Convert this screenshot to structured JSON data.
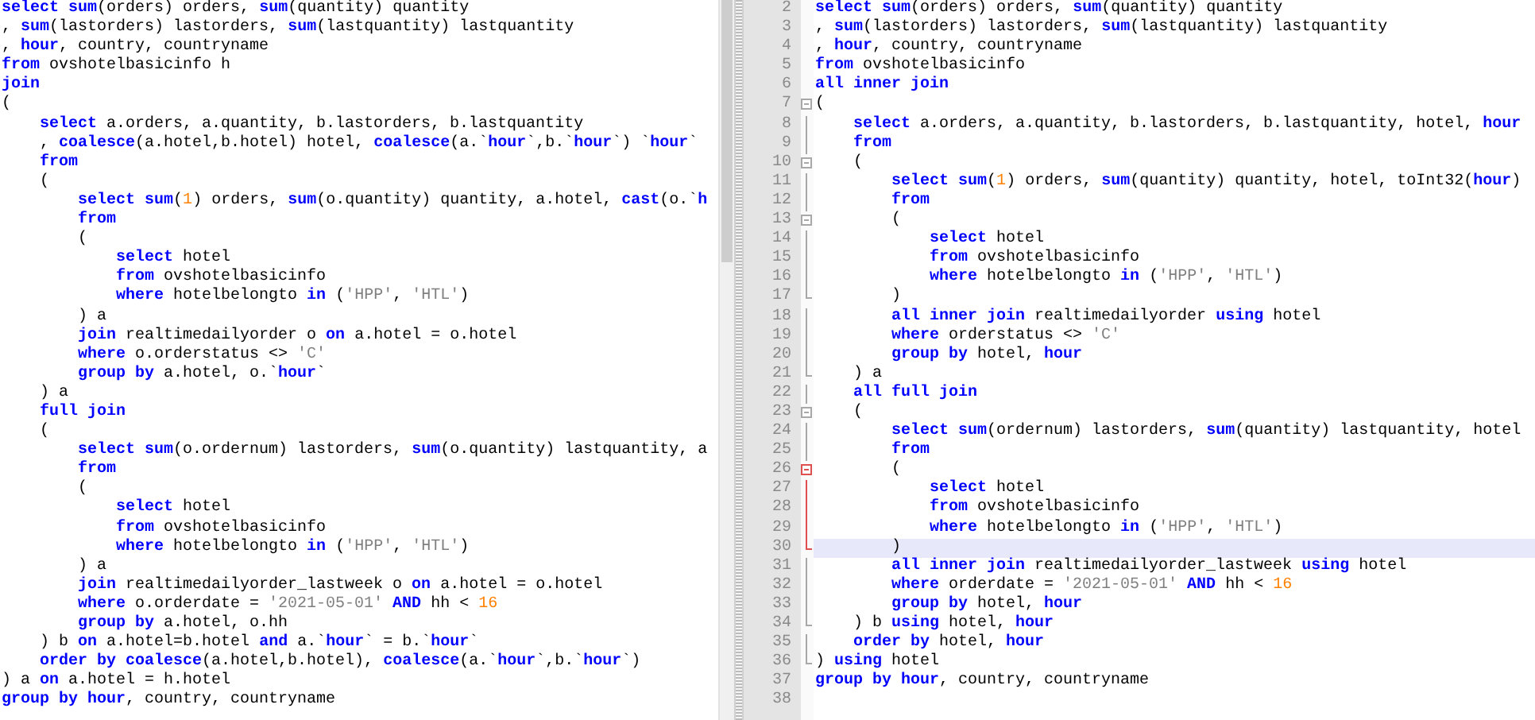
{
  "left_pane": {
    "lines": [
      {
        "tokens": [
          {
            "kind": "keyword",
            "text": "select "
          },
          {
            "kind": "keyword",
            "text": "sum"
          },
          {
            "kind": "text",
            "text": "(orders) orders, "
          },
          {
            "kind": "keyword",
            "text": "sum"
          },
          {
            "kind": "text",
            "text": "(quantity) quantity"
          }
        ]
      },
      {
        "tokens": [
          {
            "kind": "text",
            "text": ", "
          },
          {
            "kind": "keyword",
            "text": "sum"
          },
          {
            "kind": "text",
            "text": "(lastorders) lastorders, "
          },
          {
            "kind": "keyword",
            "text": "sum"
          },
          {
            "kind": "text",
            "text": "(lastquantity) lastquantity"
          }
        ]
      },
      {
        "tokens": [
          {
            "kind": "text",
            "text": ", "
          },
          {
            "kind": "keyword",
            "text": "hour"
          },
          {
            "kind": "text",
            "text": ", country, countryname"
          }
        ]
      },
      {
        "tokens": [
          {
            "kind": "keyword",
            "text": "from"
          },
          {
            "kind": "text",
            "text": " ovshotelbasicinfo h"
          }
        ]
      },
      {
        "tokens": [
          {
            "kind": "keyword",
            "text": "join"
          }
        ]
      },
      {
        "tokens": [
          {
            "kind": "text",
            "text": "("
          }
        ]
      },
      {
        "tokens": [
          {
            "kind": "keyword",
            "text": "    select"
          },
          {
            "kind": "text",
            "text": " a.orders, a.quantity, b.lastorders, b.lastquantity"
          }
        ]
      },
      {
        "tokens": [
          {
            "kind": "text",
            "text": "    , "
          },
          {
            "kind": "keyword",
            "text": "coalesce"
          },
          {
            "kind": "text",
            "text": "(a.hotel,b.hotel) hotel, "
          },
          {
            "kind": "keyword",
            "text": "coalesce"
          },
          {
            "kind": "text",
            "text": "(a.`"
          },
          {
            "kind": "keyword",
            "text": "hour"
          },
          {
            "kind": "text",
            "text": "`,b.`"
          },
          {
            "kind": "keyword",
            "text": "hour"
          },
          {
            "kind": "text",
            "text": "`) `"
          },
          {
            "kind": "keyword",
            "text": "hour"
          },
          {
            "kind": "text",
            "text": "`"
          }
        ]
      },
      {
        "tokens": [
          {
            "kind": "keyword",
            "text": "    from"
          }
        ]
      },
      {
        "tokens": [
          {
            "kind": "text",
            "text": "    ("
          }
        ]
      },
      {
        "tokens": [
          {
            "kind": "keyword",
            "text": "        select "
          },
          {
            "kind": "keyword",
            "text": "sum"
          },
          {
            "kind": "text",
            "text": "("
          },
          {
            "kind": "number",
            "text": "1"
          },
          {
            "kind": "text",
            "text": ") orders, "
          },
          {
            "kind": "keyword",
            "text": "sum"
          },
          {
            "kind": "text",
            "text": "(o.quantity) quantity, a.hotel, "
          },
          {
            "kind": "keyword",
            "text": "cast"
          },
          {
            "kind": "text",
            "text": "(o.`"
          },
          {
            "kind": "keyword",
            "text": "h"
          }
        ]
      },
      {
        "tokens": [
          {
            "kind": "keyword",
            "text": "        from"
          }
        ]
      },
      {
        "tokens": [
          {
            "kind": "text",
            "text": "        ("
          }
        ]
      },
      {
        "tokens": [
          {
            "kind": "keyword",
            "text": "            select"
          },
          {
            "kind": "text",
            "text": " hotel"
          }
        ]
      },
      {
        "tokens": [
          {
            "kind": "keyword",
            "text": "            from"
          },
          {
            "kind": "text",
            "text": " ovshotelbasicinfo"
          }
        ]
      },
      {
        "tokens": [
          {
            "kind": "keyword",
            "text": "            where"
          },
          {
            "kind": "text",
            "text": " hotelbelongto "
          },
          {
            "kind": "keyword",
            "text": "in"
          },
          {
            "kind": "text",
            "text": " ("
          },
          {
            "kind": "string",
            "text": "'HPP'"
          },
          {
            "kind": "text",
            "text": ", "
          },
          {
            "kind": "string",
            "text": "'HTL'"
          },
          {
            "kind": "text",
            "text": ")"
          }
        ]
      },
      {
        "tokens": [
          {
            "kind": "text",
            "text": "        ) a"
          }
        ]
      },
      {
        "tokens": [
          {
            "kind": "keyword",
            "text": "        join"
          },
          {
            "kind": "text",
            "text": " realtimedailyorder o "
          },
          {
            "kind": "keyword",
            "text": "on"
          },
          {
            "kind": "text",
            "text": " a.hotel = o.hotel"
          }
        ]
      },
      {
        "tokens": [
          {
            "kind": "keyword",
            "text": "        where"
          },
          {
            "kind": "text",
            "text": " o.orderstatus <> "
          },
          {
            "kind": "string",
            "text": "'C'"
          }
        ]
      },
      {
        "tokens": [
          {
            "kind": "keyword",
            "text": "        group by"
          },
          {
            "kind": "text",
            "text": " a.hotel, o.`"
          },
          {
            "kind": "keyword",
            "text": "hour"
          },
          {
            "kind": "text",
            "text": "`"
          }
        ]
      },
      {
        "tokens": [
          {
            "kind": "text",
            "text": "    ) a"
          }
        ]
      },
      {
        "tokens": [
          {
            "kind": "keyword",
            "text": "    full join"
          }
        ]
      },
      {
        "tokens": [
          {
            "kind": "text",
            "text": "    ("
          }
        ]
      },
      {
        "tokens": [
          {
            "kind": "keyword",
            "text": "        select "
          },
          {
            "kind": "keyword",
            "text": "sum"
          },
          {
            "kind": "text",
            "text": "(o.ordernum) lastorders, "
          },
          {
            "kind": "keyword",
            "text": "sum"
          },
          {
            "kind": "text",
            "text": "(o.quantity) lastquantity, a"
          }
        ]
      },
      {
        "tokens": [
          {
            "kind": "keyword",
            "text": "        from"
          }
        ]
      },
      {
        "tokens": [
          {
            "kind": "text",
            "text": "        ("
          }
        ]
      },
      {
        "tokens": [
          {
            "kind": "keyword",
            "text": "            select"
          },
          {
            "kind": "text",
            "text": " hotel"
          }
        ]
      },
      {
        "tokens": [
          {
            "kind": "keyword",
            "text": "            from"
          },
          {
            "kind": "text",
            "text": " ovshotelbasicinfo"
          }
        ]
      },
      {
        "tokens": [
          {
            "kind": "keyword",
            "text": "            where"
          },
          {
            "kind": "text",
            "text": " hotelbelongto "
          },
          {
            "kind": "keyword",
            "text": "in"
          },
          {
            "kind": "text",
            "text": " ("
          },
          {
            "kind": "string",
            "text": "'HPP'"
          },
          {
            "kind": "text",
            "text": ", "
          },
          {
            "kind": "string",
            "text": "'HTL'"
          },
          {
            "kind": "text",
            "text": ")"
          }
        ]
      },
      {
        "tokens": [
          {
            "kind": "text",
            "text": "        ) a"
          }
        ]
      },
      {
        "tokens": [
          {
            "kind": "keyword",
            "text": "        join"
          },
          {
            "kind": "text",
            "text": " realtimedailyorder_lastweek o "
          },
          {
            "kind": "keyword",
            "text": "on"
          },
          {
            "kind": "text",
            "text": " a.hotel = o.hotel"
          }
        ]
      },
      {
        "tokens": [
          {
            "kind": "keyword",
            "text": "        where"
          },
          {
            "kind": "text",
            "text": " o.orderdate = "
          },
          {
            "kind": "string",
            "text": "'2021-05-01'"
          },
          {
            "kind": "keyword",
            "text": " AND"
          },
          {
            "kind": "text",
            "text": " hh < "
          },
          {
            "kind": "number",
            "text": "16"
          }
        ]
      },
      {
        "tokens": [
          {
            "kind": "keyword",
            "text": "        group by"
          },
          {
            "kind": "text",
            "text": " a.hotel, o.hh"
          }
        ]
      },
      {
        "tokens": [
          {
            "kind": "text",
            "text": "    ) b "
          },
          {
            "kind": "keyword",
            "text": "on"
          },
          {
            "kind": "text",
            "text": " a.hotel=b.hotel "
          },
          {
            "kind": "keyword",
            "text": "and"
          },
          {
            "kind": "text",
            "text": " a.`"
          },
          {
            "kind": "keyword",
            "text": "hour"
          },
          {
            "kind": "text",
            "text": "` = b.`"
          },
          {
            "kind": "keyword",
            "text": "hour"
          },
          {
            "kind": "text",
            "text": "`"
          }
        ]
      },
      {
        "tokens": [
          {
            "kind": "keyword",
            "text": "    order by "
          },
          {
            "kind": "keyword",
            "text": "coalesce"
          },
          {
            "kind": "text",
            "text": "(a.hotel,b.hotel), "
          },
          {
            "kind": "keyword",
            "text": "coalesce"
          },
          {
            "kind": "text",
            "text": "(a.`"
          },
          {
            "kind": "keyword",
            "text": "hour"
          },
          {
            "kind": "text",
            "text": "`,b.`"
          },
          {
            "kind": "keyword",
            "text": "hour"
          },
          {
            "kind": "text",
            "text": "`)"
          }
        ]
      },
      {
        "tokens": [
          {
            "kind": "text",
            "text": ") a "
          },
          {
            "kind": "keyword",
            "text": "on"
          },
          {
            "kind": "text",
            "text": " a.hotel = h.hotel"
          }
        ]
      },
      {
        "tokens": [
          {
            "kind": "keyword",
            "text": "group by "
          },
          {
            "kind": "keyword",
            "text": "hour"
          },
          {
            "kind": "text",
            "text": ", country, countryname"
          }
        ]
      }
    ]
  },
  "right_pane": {
    "lines": [
      {
        "number": "2",
        "current": false,
        "tokens": [
          {
            "kind": "keyword",
            "text": "select "
          },
          {
            "kind": "keyword",
            "text": "sum"
          },
          {
            "kind": "text",
            "text": "(orders) orders, "
          },
          {
            "kind": "keyword",
            "text": "sum"
          },
          {
            "kind": "text",
            "text": "(quantity) quantity"
          }
        ]
      },
      {
        "number": "3",
        "current": false,
        "tokens": [
          {
            "kind": "text",
            "text": ", "
          },
          {
            "kind": "keyword",
            "text": "sum"
          },
          {
            "kind": "text",
            "text": "(lastorders) lastorders, "
          },
          {
            "kind": "keyword",
            "text": "sum"
          },
          {
            "kind": "text",
            "text": "(lastquantity) lastquantity"
          }
        ]
      },
      {
        "number": "4",
        "current": false,
        "tokens": [
          {
            "kind": "text",
            "text": ", "
          },
          {
            "kind": "keyword",
            "text": "hour"
          },
          {
            "kind": "text",
            "text": ", country, countryname"
          }
        ]
      },
      {
        "number": "5",
        "current": false,
        "tokens": [
          {
            "kind": "keyword",
            "text": "from"
          },
          {
            "kind": "text",
            "text": " ovshotelbasicinfo"
          }
        ]
      },
      {
        "number": "6",
        "current": false,
        "tokens": [
          {
            "kind": "keyword",
            "text": "all inner join"
          }
        ]
      },
      {
        "number": "7",
        "current": false,
        "kind": "open",
        "marked": false,
        "tokens": [
          {
            "kind": "text",
            "text": "("
          }
        ]
      },
      {
        "number": "8",
        "current": false,
        "kind": "mid",
        "marked": false,
        "tokens": [
          {
            "kind": "keyword",
            "text": "    select"
          },
          {
            "kind": "text",
            "text": " a.orders, a.quantity, b.lastorders, b.lastquantity, hotel, "
          },
          {
            "kind": "keyword",
            "text": "hour"
          }
        ]
      },
      {
        "number": "9",
        "current": false,
        "kind": "mid",
        "marked": false,
        "tokens": [
          {
            "kind": "keyword",
            "text": "    from"
          }
        ]
      },
      {
        "number": "10",
        "current": false,
        "kind": "open",
        "marked": false,
        "tokens": [
          {
            "kind": "text",
            "text": "    ("
          }
        ]
      },
      {
        "number": "11",
        "current": false,
        "kind": "mid",
        "marked": false,
        "tokens": [
          {
            "kind": "keyword",
            "text": "        select "
          },
          {
            "kind": "keyword",
            "text": "sum"
          },
          {
            "kind": "text",
            "text": "("
          },
          {
            "kind": "number",
            "text": "1"
          },
          {
            "kind": "text",
            "text": ") orders, "
          },
          {
            "kind": "keyword",
            "text": "sum"
          },
          {
            "kind": "text",
            "text": "(quantity) quantity, hotel, toInt32("
          },
          {
            "kind": "keyword",
            "text": "hour"
          },
          {
            "kind": "text",
            "text": ")"
          }
        ]
      },
      {
        "number": "12",
        "current": false,
        "kind": "mid",
        "marked": false,
        "tokens": [
          {
            "kind": "keyword",
            "text": "        from"
          }
        ]
      },
      {
        "number": "13",
        "current": false,
        "kind": "open",
        "marked": false,
        "tokens": [
          {
            "kind": "text",
            "text": "        ("
          }
        ]
      },
      {
        "number": "14",
        "current": false,
        "kind": "mid",
        "marked": false,
        "tokens": [
          {
            "kind": "keyword",
            "text": "            select"
          },
          {
            "kind": "text",
            "text": " hotel"
          }
        ]
      },
      {
        "number": "15",
        "current": false,
        "kind": "mid",
        "marked": false,
        "tokens": [
          {
            "kind": "keyword",
            "text": "            from"
          },
          {
            "kind": "text",
            "text": " ovshotelbasicinfo"
          }
        ]
      },
      {
        "number": "16",
        "current": false,
        "kind": "mid",
        "marked": false,
        "tokens": [
          {
            "kind": "keyword",
            "text": "            where"
          },
          {
            "kind": "text",
            "text": " hotelbelongto "
          },
          {
            "kind": "keyword",
            "text": "in"
          },
          {
            "kind": "text",
            "text": " ("
          },
          {
            "kind": "string",
            "text": "'HPP'"
          },
          {
            "kind": "text",
            "text": ", "
          },
          {
            "kind": "string",
            "text": "'HTL'"
          },
          {
            "kind": "text",
            "text": ")"
          }
        ]
      },
      {
        "number": "17",
        "current": false,
        "kind": "end",
        "marked": false,
        "tokens": [
          {
            "kind": "text",
            "text": "        )"
          }
        ]
      },
      {
        "number": "18",
        "current": false,
        "kind": "mid",
        "marked": false,
        "tokens": [
          {
            "kind": "keyword",
            "text": "        all inner join"
          },
          {
            "kind": "text",
            "text": " realtimedailyorder "
          },
          {
            "kind": "keyword",
            "text": "using"
          },
          {
            "kind": "text",
            "text": " hotel"
          }
        ]
      },
      {
        "number": "19",
        "current": false,
        "kind": "mid",
        "marked": false,
        "tokens": [
          {
            "kind": "keyword",
            "text": "        where"
          },
          {
            "kind": "text",
            "text": " orderstatus <> "
          },
          {
            "kind": "string",
            "text": "'C'"
          }
        ]
      },
      {
        "number": "20",
        "current": false,
        "kind": "mid",
        "marked": false,
        "tokens": [
          {
            "kind": "keyword",
            "text": "        group by"
          },
          {
            "kind": "text",
            "text": " hotel, "
          },
          {
            "kind": "keyword",
            "text": "hour"
          }
        ]
      },
      {
        "number": "21",
        "current": false,
        "kind": "end",
        "marked": false,
        "tokens": [
          {
            "kind": "text",
            "text": "    ) a"
          }
        ]
      },
      {
        "number": "22",
        "current": false,
        "kind": "mid",
        "marked": false,
        "tokens": [
          {
            "kind": "keyword",
            "text": "    all full join"
          }
        ]
      },
      {
        "number": "23",
        "current": false,
        "kind": "open",
        "marked": false,
        "tokens": [
          {
            "kind": "text",
            "text": "    ("
          }
        ]
      },
      {
        "number": "24",
        "current": false,
        "kind": "mid",
        "marked": false,
        "tokens": [
          {
            "kind": "keyword",
            "text": "        select "
          },
          {
            "kind": "keyword",
            "text": "sum"
          },
          {
            "kind": "text",
            "text": "(ordernum) lastorders, "
          },
          {
            "kind": "keyword",
            "text": "sum"
          },
          {
            "kind": "text",
            "text": "(quantity) lastquantity, hotel"
          }
        ]
      },
      {
        "number": "25",
        "current": false,
        "kind": "mid",
        "marked": false,
        "tokens": [
          {
            "kind": "keyword",
            "text": "        from"
          }
        ]
      },
      {
        "number": "26",
        "current": false,
        "kind": "open",
        "marked": true,
        "tokens": [
          {
            "kind": "text",
            "text": "        ("
          }
        ]
      },
      {
        "number": "27",
        "current": false,
        "kind": "mid",
        "marked": true,
        "tokens": [
          {
            "kind": "keyword",
            "text": "            select"
          },
          {
            "kind": "text",
            "text": " hotel"
          }
        ]
      },
      {
        "number": "28",
        "current": false,
        "kind": "mid",
        "marked": true,
        "tokens": [
          {
            "kind": "keyword",
            "text": "            from"
          },
          {
            "kind": "text",
            "text": " ovshotelbasicinfo"
          }
        ]
      },
      {
        "number": "29",
        "current": false,
        "kind": "mid",
        "marked": true,
        "tokens": [
          {
            "kind": "keyword",
            "text": "            where"
          },
          {
            "kind": "text",
            "text": " hotelbelongto "
          },
          {
            "kind": "keyword",
            "text": "in"
          },
          {
            "kind": "text",
            "text": " ("
          },
          {
            "kind": "string",
            "text": "'HPP'"
          },
          {
            "kind": "text",
            "text": ", "
          },
          {
            "kind": "string",
            "text": "'HTL'"
          },
          {
            "kind": "text",
            "text": ")"
          }
        ]
      },
      {
        "number": "30",
        "current": true,
        "kind": "end",
        "marked": true,
        "tokens": [
          {
            "kind": "text",
            "text": "        )"
          }
        ]
      },
      {
        "number": "31",
        "current": false,
        "kind": "mid",
        "marked": false,
        "tokens": [
          {
            "kind": "keyword",
            "text": "        all inner join"
          },
          {
            "kind": "text",
            "text": " realtimedailyorder_lastweek "
          },
          {
            "kind": "keyword",
            "text": "using"
          },
          {
            "kind": "text",
            "text": " hotel"
          }
        ]
      },
      {
        "number": "32",
        "current": false,
        "kind": "mid",
        "marked": false,
        "tokens": [
          {
            "kind": "keyword",
            "text": "        where"
          },
          {
            "kind": "text",
            "text": " orderdate = "
          },
          {
            "kind": "string",
            "text": "'2021-05-01'"
          },
          {
            "kind": "keyword",
            "text": " AND"
          },
          {
            "kind": "text",
            "text": " hh < "
          },
          {
            "kind": "number",
            "text": "16"
          }
        ]
      },
      {
        "number": "33",
        "current": false,
        "kind": "mid",
        "marked": false,
        "tokens": [
          {
            "kind": "keyword",
            "text": "        group by"
          },
          {
            "kind": "text",
            "text": " hotel, "
          },
          {
            "kind": "keyword",
            "text": "hour"
          }
        ]
      },
      {
        "number": "34",
        "current": false,
        "kind": "end",
        "marked": false,
        "tokens": [
          {
            "kind": "text",
            "text": "    ) b "
          },
          {
            "kind": "keyword",
            "text": "using"
          },
          {
            "kind": "text",
            "text": " hotel, "
          },
          {
            "kind": "keyword",
            "text": "hour"
          }
        ]
      },
      {
        "number": "35",
        "current": false,
        "kind": "mid",
        "marked": false,
        "tokens": [
          {
            "kind": "keyword",
            "text": "    order by"
          },
          {
            "kind": "text",
            "text": " hotel, "
          },
          {
            "kind": "keyword",
            "text": "hour"
          }
        ]
      },
      {
        "number": "36",
        "current": false,
        "kind": "end",
        "marked": false,
        "tokens": [
          {
            "kind": "text",
            "text": ") "
          },
          {
            "kind": "keyword",
            "text": "using"
          },
          {
            "kind": "text",
            "text": " hotel"
          }
        ]
      },
      {
        "number": "37",
        "current": false,
        "tokens": [
          {
            "kind": "keyword",
            "text": "group by "
          },
          {
            "kind": "keyword",
            "text": "hour"
          },
          {
            "kind": "text",
            "text": ", country, countryname"
          }
        ]
      },
      {
        "number": "38"
      }
    ]
  }
}
